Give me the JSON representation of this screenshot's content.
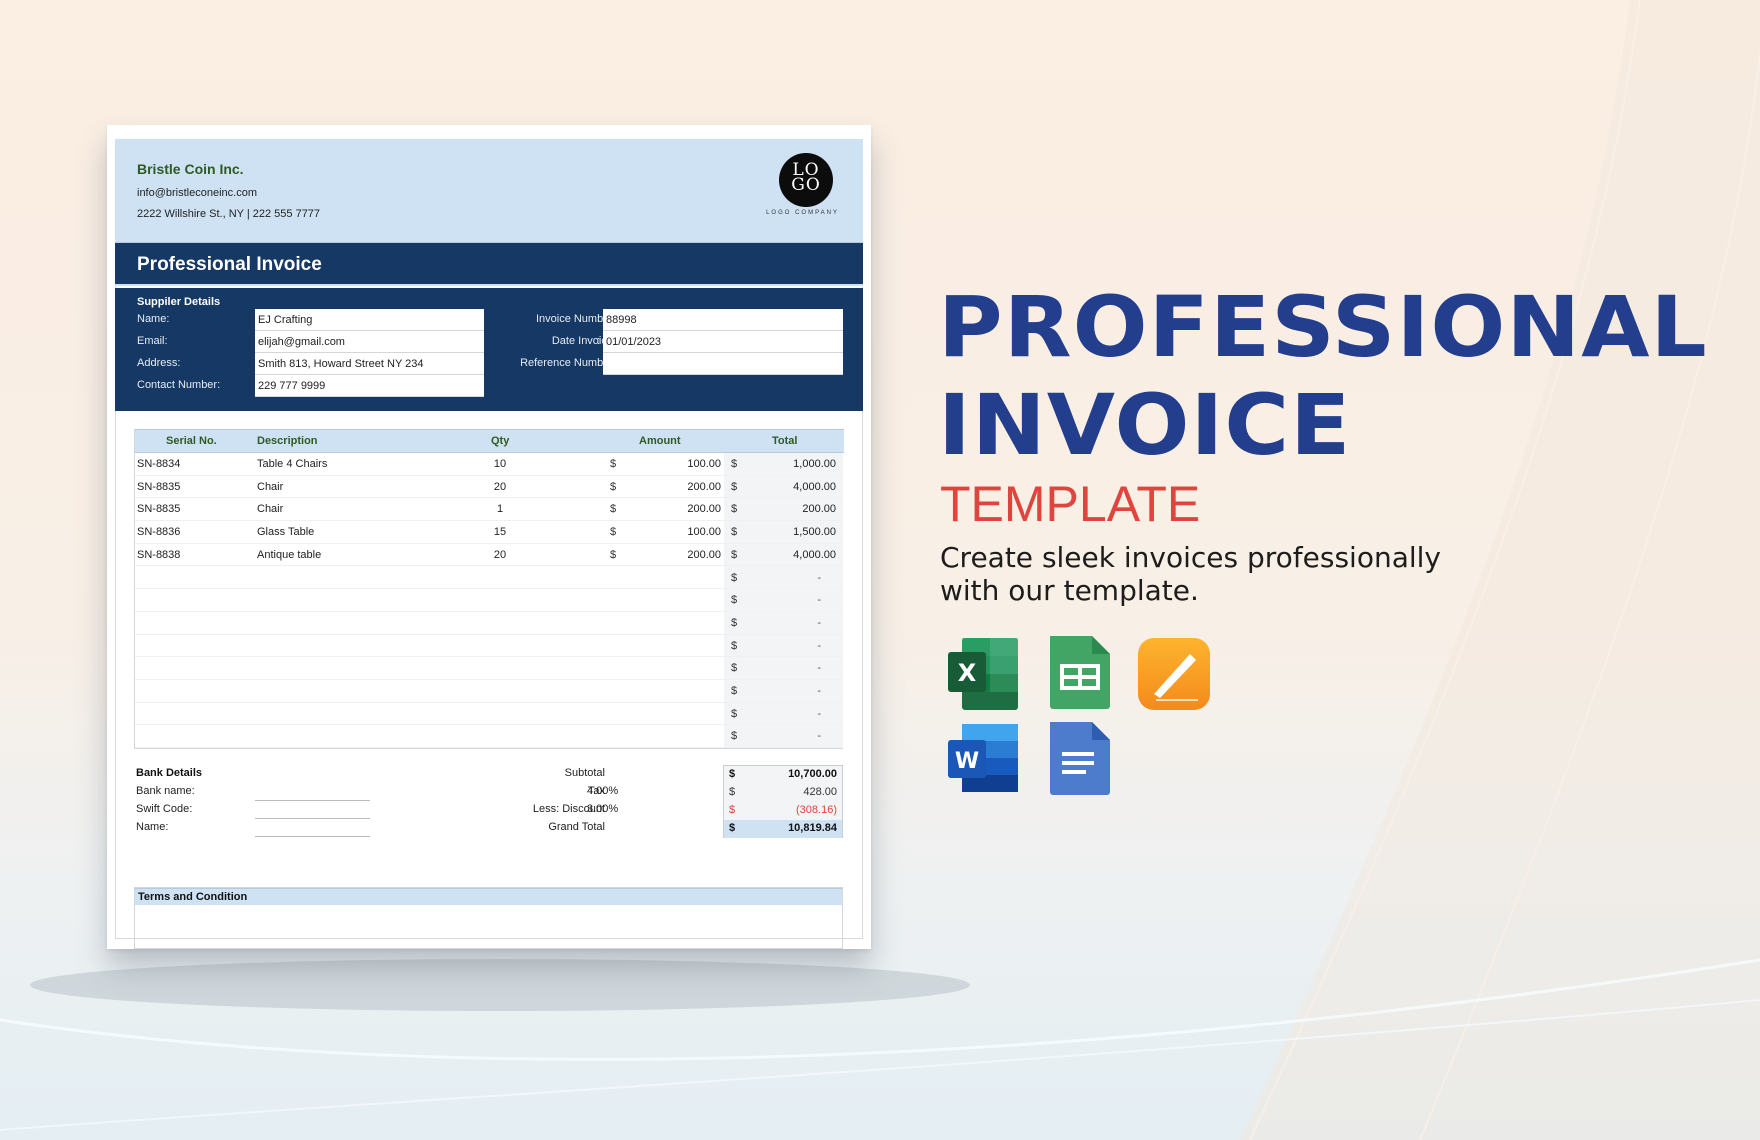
{
  "company": {
    "name": "Bristle Coin Inc.",
    "email": "info@bristleconeinc.com",
    "address_phone": "2222 Willshire St., NY | 222 555 7777",
    "logo_text_top": "LO",
    "logo_text_bottom": "GO",
    "logo_caption": "LOGO COMPANY"
  },
  "invoice_title": "Professional Invoice",
  "supplier": {
    "section_title": "Suppiler Details",
    "fields": [
      {
        "label": "Name:",
        "value": "EJ Crafting"
      },
      {
        "label": "Email:",
        "value": "elijah@gmail.com"
      },
      {
        "label": "Address:",
        "value": "Smith 813, Howard Street NY 234"
      },
      {
        "label": "Contact Number:",
        "value": "229 777 9999"
      }
    ]
  },
  "invoice_info": [
    {
      "label": "Invoice Number",
      "value": "88998"
    },
    {
      "label": "Date Invoice",
      "value": "01/01/2023"
    },
    {
      "label": "Reference Number",
      "value": ""
    }
  ],
  "colon": ":",
  "items": {
    "headers": [
      "Serial No.",
      "Description",
      "Qty",
      "Amount",
      "Total"
    ],
    "currency": "$",
    "empty_total": "-",
    "rows": [
      {
        "serial": "SN-8834",
        "description": "Table 4 Chairs",
        "qty": "10",
        "amount": "100.00",
        "total": "1,000.00"
      },
      {
        "serial": "SN-8835",
        "description": "Chair",
        "qty": "20",
        "amount": "200.00",
        "total": "4,000.00"
      },
      {
        "serial": "SN-8835",
        "description": "Chair",
        "qty": "1",
        "amount": "200.00",
        "total": "200.00"
      },
      {
        "serial": "SN-8836",
        "description": "Glass Table",
        "qty": "15",
        "amount": "100.00",
        "total": "1,500.00"
      },
      {
        "serial": "SN-8838",
        "description": "Antique table",
        "qty": "20",
        "amount": "200.00",
        "total": "4,000.00"
      }
    ],
    "empty_rows": 8
  },
  "bank": {
    "title": "Bank Details",
    "fields": [
      "Bank name:",
      "Swift Code:",
      "Name:"
    ]
  },
  "summary": {
    "subtotal_label": "Subtotal",
    "subtotal": "10,700.00",
    "tax_label": "Tax",
    "tax_pct": "4.00%",
    "tax": "428.00",
    "discount_label": "Less: Discount",
    "discount_pct": "3.00%",
    "discount": "(308.16)",
    "grand_label": "Grand Total",
    "grand_total": "10,819.84",
    "currency": "$"
  },
  "terms_title": "Terms and Condition",
  "hero": {
    "line1": "PROFESSIONAL",
    "line2": "INVOICE",
    "line3": "TEMPLATE",
    "tagline": "Create sleek invoices professionally with our template."
  },
  "app_icons": [
    "excel-icon",
    "google-sheets-icon",
    "pages-icon",
    "word-icon",
    "google-docs-icon"
  ],
  "colors": {
    "navy": "#163865",
    "header_blue": "#cfe2f3",
    "hero_blue": "#243e8e",
    "accent_red": "#e0443e",
    "header_green_text": "#2e5a24"
  }
}
